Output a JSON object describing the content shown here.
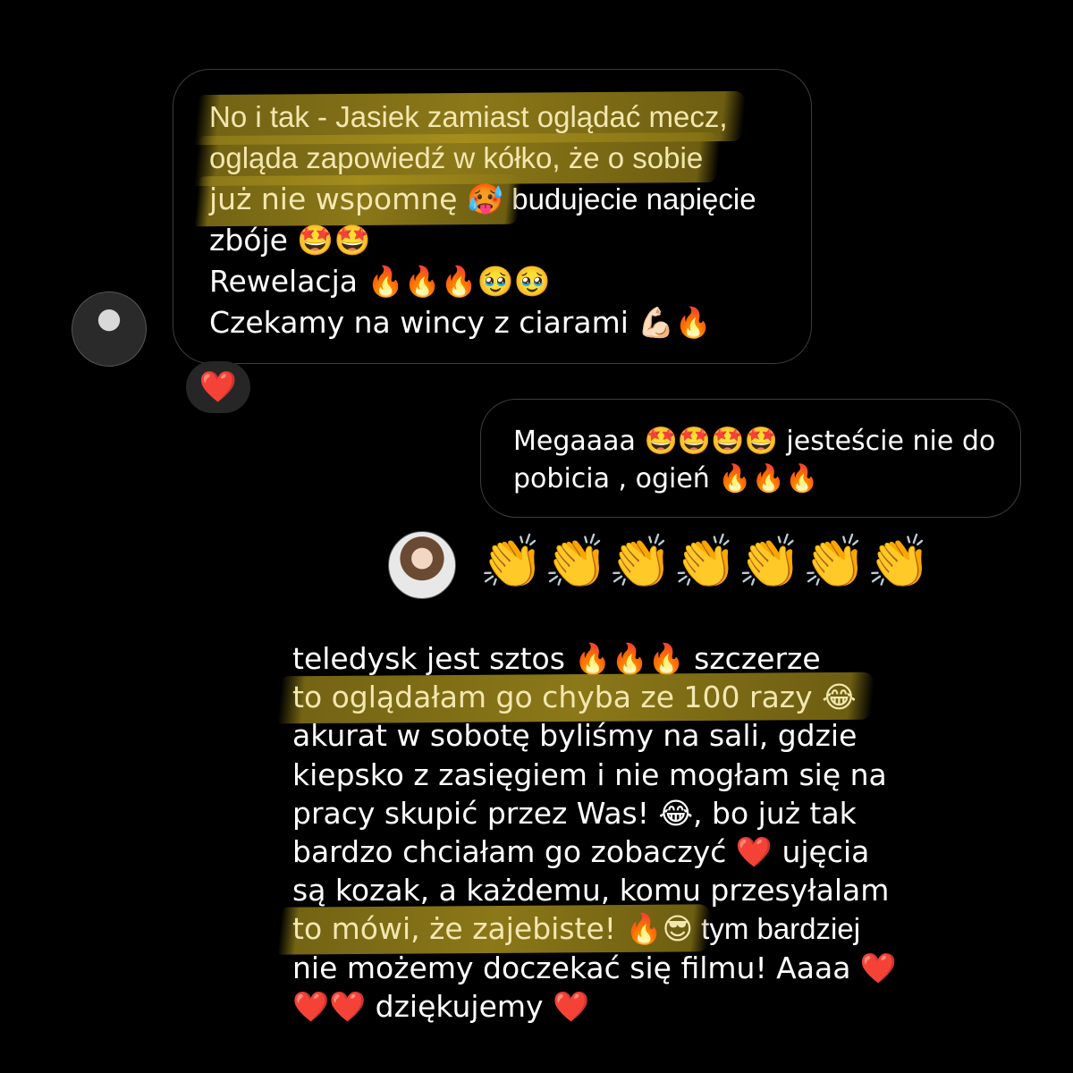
{
  "messages": [
    {
      "lines": [
        "No i tak - Jasiek zamiast oglądać mecz,",
        "ogląda zapowiedź w kółko, że o sobie",
        "już nie wspomnę 🥵",
        " budujecie napięcie",
        "zbóje 🤩🤩",
        "Rewelacja 🔥🔥🔥🥹🥹",
        "Czekamy na wincy z ciarami 💪🏻🔥"
      ],
      "reaction": "❤️"
    },
    {
      "lines": [
        "Megaaaa 🤩🤩🤩🤩 jesteście nie do",
        "pobicia , ogień 🔥🔥🔥"
      ]
    },
    {
      "lines": [
        "👏👏👏👏👏👏👏"
      ]
    },
    {
      "lines": [
        "teledysk jest sztos 🔥🔥🔥 szczerze",
        "to oglądałam go chyba ze 100 razy 😂",
        "akurat w sobotę byliśmy na sali, gdzie",
        "kiepsko z zasięgiem i nie mogłam się na",
        "pracy skupić przez Was! 😂, bo już tak",
        "bardzo chciałam go zobaczyć ❤️ ujęcia",
        "są kozak, a każdemu, komu przesyłalam",
        "to mówi, że zajebiste! 🔥😎",
        " tym bardziej",
        "nie możemy doczekać się filmu! Aaaa ❤️",
        "❤️❤️ dziękujemy ❤️"
      ]
    }
  ],
  "colors": {
    "background": "#000000",
    "bubble_border": "#3d3d3d",
    "text": "#ffffff",
    "highlight": "#aa921e",
    "reaction_bg": "#262626"
  }
}
